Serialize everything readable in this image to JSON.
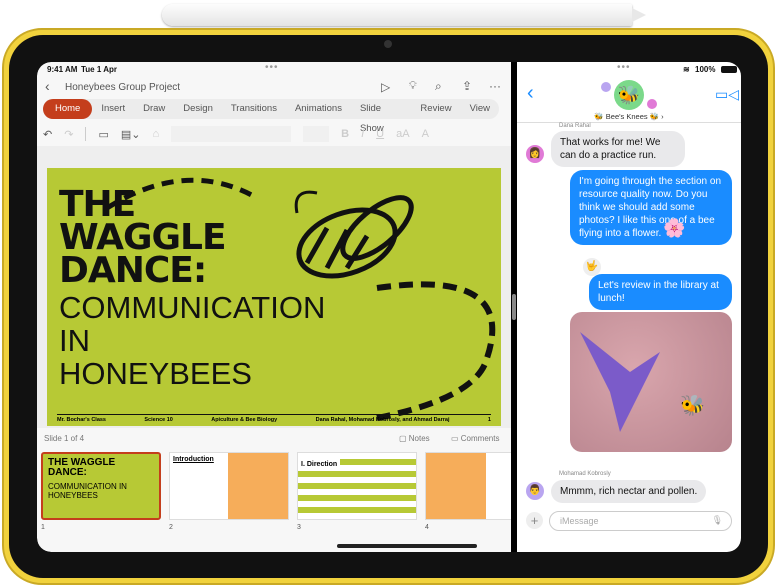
{
  "status": {
    "time": "9:41 AM",
    "date": "Tue 1 Apr",
    "battery": "100%"
  },
  "ppt": {
    "doc_title": "Honeybees Group Project",
    "tabs": [
      "Home",
      "Insert",
      "Draw",
      "Design",
      "Transitions",
      "Animations",
      "Slide Show",
      "Review",
      "View"
    ],
    "active_tab": "Home",
    "accent": "#c43e1c",
    "toolbar_icons": [
      "undo-icon",
      "redo-icon",
      "new-slide-icon",
      "layout-icon",
      "format-painter-icon",
      "bold-icon",
      "italic-icon",
      "underline-icon",
      "font-size-icon",
      "font-color-icon"
    ],
    "toolbar_glyphs": {
      "bold": "B",
      "italic": "I",
      "underline": "U",
      "font_size": "aA",
      "font_color": "A"
    },
    "slide": {
      "line1": "THE",
      "line2": "WAGGLE",
      "line3": "DANCE:",
      "line4": "COMMUNICATION",
      "line5": "IN",
      "line6": "HONEYBEES",
      "footer": [
        "Mr. Bochar's Class",
        "Science 10",
        "Apiculture & Bee Biology",
        "Dana Rahal, Mohamad Kobrosly, and Ahmad Darraj",
        "1"
      ],
      "bg": "#b7c935"
    },
    "slide_counter": "Slide 1 of 4",
    "notes_label": "Notes",
    "comments_label": "Comments",
    "thumbnails": [
      {
        "num": "1",
        "title": "THE WAGGLE DANCE:",
        "subtitle": "COMMUNICATION IN HONEYBEES"
      },
      {
        "num": "2",
        "title": "Introduction"
      },
      {
        "num": "3",
        "title": "I. Direction"
      },
      {
        "num": "4",
        "title": ""
      }
    ]
  },
  "messages": {
    "group_name": "Bee's Knees",
    "sender_top": "Dana Rahal",
    "items": [
      {
        "dir": "in",
        "text": "That works for me! We can do a practice run."
      },
      {
        "dir": "out",
        "text": "I'm going through the section on resource quality now. Do you think we should add some photos? I like this one of a bee flying into a flower."
      },
      {
        "dir": "out",
        "text": "Let's review in the library at lunch!"
      },
      {
        "dir": "in",
        "sender": "Mohamad Kobrosly",
        "text": "Mmmm, rich nectar and pollen."
      }
    ],
    "input_placeholder": "iMessage",
    "bubble_color": "#1a8cff"
  }
}
